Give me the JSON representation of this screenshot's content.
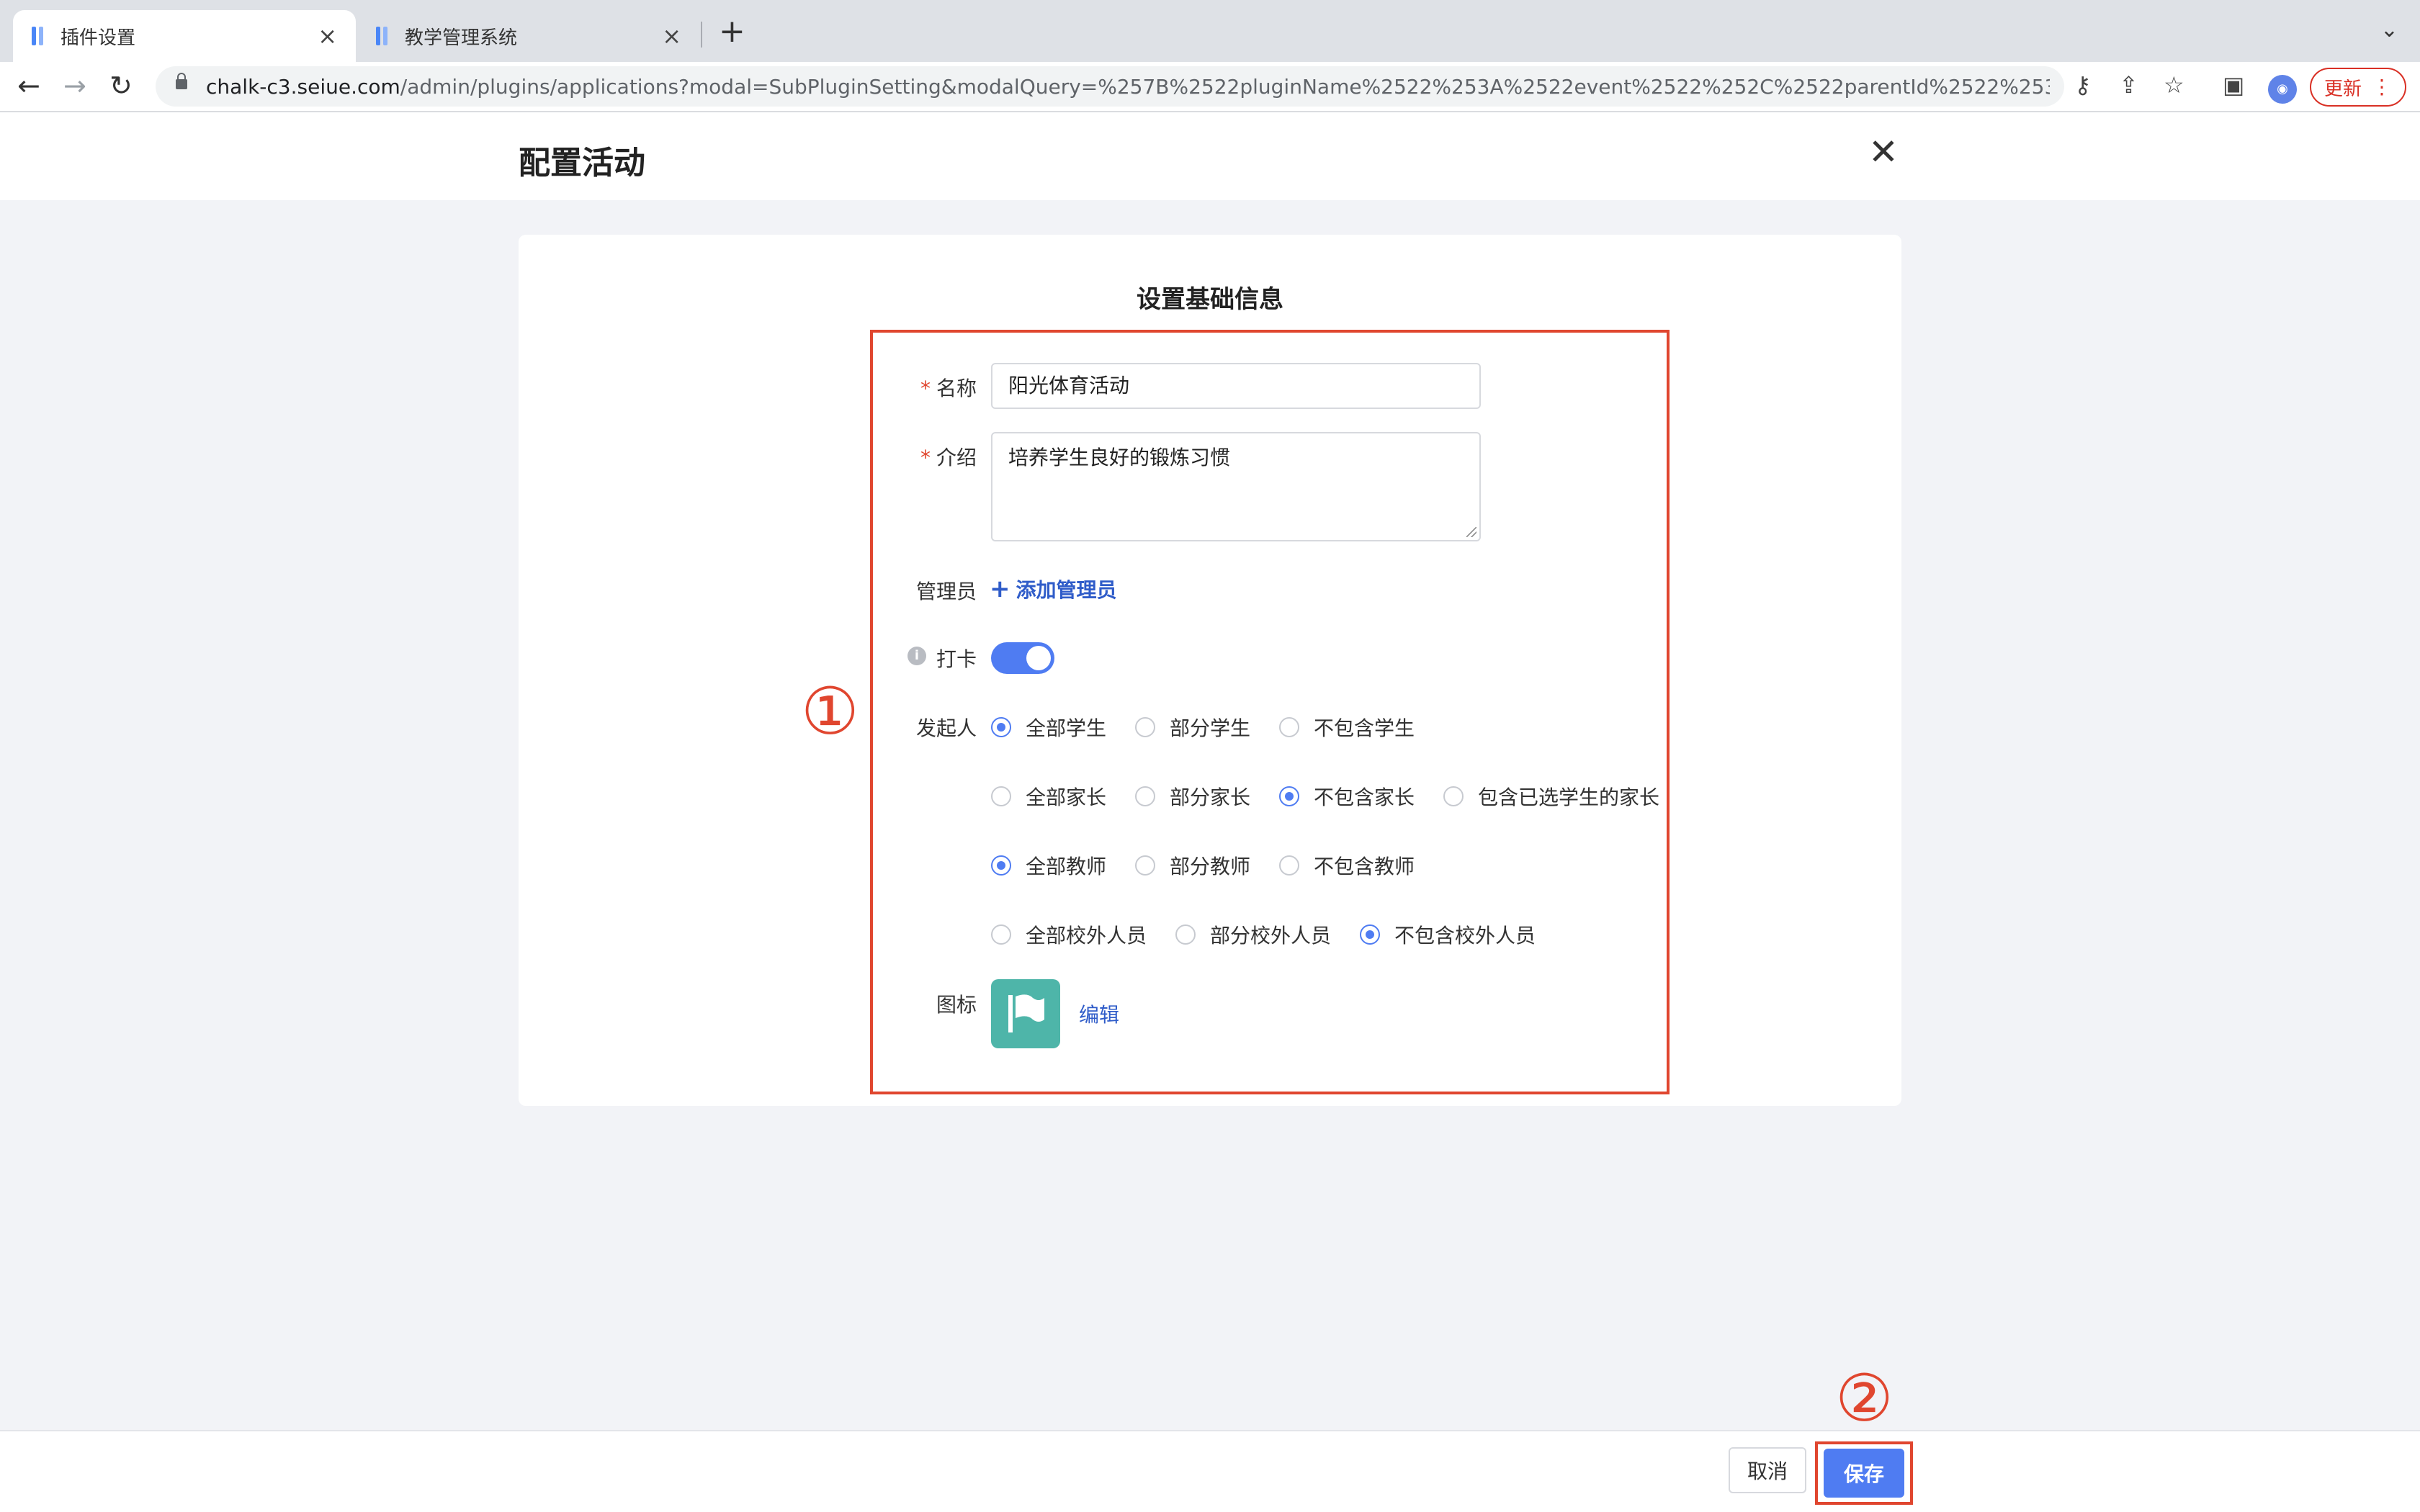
{
  "browser": {
    "tabs": [
      {
        "label": "插件设置",
        "active": true
      },
      {
        "label": "教学管理系统",
        "active": false
      }
    ],
    "url_host": "chalk-c3.seiue.com",
    "url_path": "/admin/plugins/applications?modal=SubPluginSetting&modalQuery=%257B%2522pluginName%2522%253A%2522event%2522%252C%2522parentId%2522%253A%2522...",
    "update_label": "更新",
    "accent": "#4a86f7"
  },
  "page": {
    "title": "配置活动",
    "section_title": "设置基础信息"
  },
  "form": {
    "name_label": "名称",
    "name_value": "阳光体育活动",
    "intro_label": "介绍",
    "intro_value": "培养学生良好的锻炼习惯",
    "admin_label": "管理员",
    "add_admin": "添加管理员",
    "checkin_label": "打卡",
    "checkin_enabled": true,
    "initiator_label": "发起人",
    "students": {
      "options": [
        "全部学生",
        "部分学生",
        "不包含学生"
      ],
      "selected": "全部学生"
    },
    "parents": {
      "options": [
        "全部家长",
        "部分家长",
        "不包含家长",
        "包含已选学生的家长"
      ],
      "selected": "不包含家长"
    },
    "teachers": {
      "options": [
        "全部教师",
        "部分教师",
        "不包含教师"
      ],
      "selected": "全部教师"
    },
    "external": {
      "options": [
        "全部校外人员",
        "部分校外人员",
        "不包含校外人员"
      ],
      "selected": "不包含校外人员"
    },
    "icon_label": "图标",
    "icon_name": "flag-icon",
    "edit_label": "编辑",
    "primary_color": "#4f7cf2"
  },
  "annotations": {
    "marker_1": "①",
    "marker_2": "②",
    "color": "#e0462f"
  },
  "footer": {
    "cancel_label": "取消",
    "save_label": "保存"
  }
}
